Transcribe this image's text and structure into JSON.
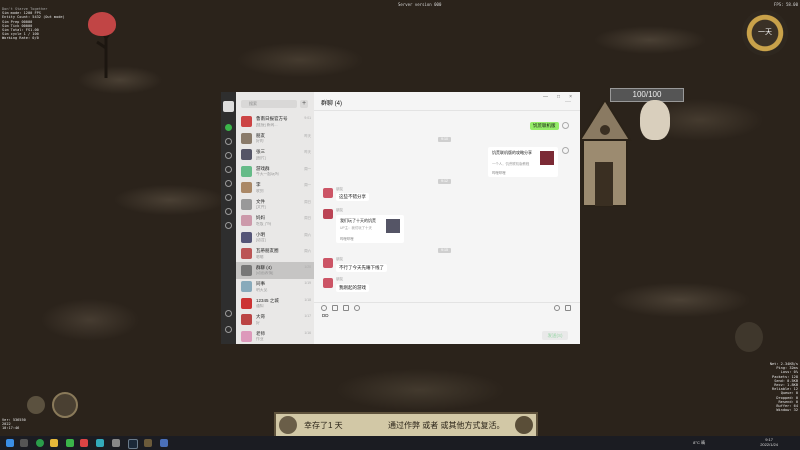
{
  "game": {
    "window_title": "Don't Starve Together",
    "center_title": "Server version 000",
    "fps": "FPS: 58.00",
    "debug_left": [
      "Sim mode: 1200 FPS",
      "Entity Count: 5432 (Out mode)",
      "Sim Prep 00000",
      "Sim Tick 00000",
      "Sim Total: FS1.00",
      "Sim cycle 1 / 100",
      "Working Rate: 0/0"
    ],
    "debug_right": [
      "Net: 2.34KB/s",
      "Ping: 32ms",
      "Loss: 0%",
      "Packets: 128",
      "Send: 0.5KB",
      "Recv: 1.8KB",
      "Reliable: 12",
      "Queue: 0",
      "Dropped: 0",
      "Resend: 0",
      "Buffer: 64",
      "Window: 32"
    ],
    "debug_bottom": [
      "Ver: 536550",
      "2022",
      "10:17:46"
    ],
    "clock_label": "一天",
    "health_label": "100/100",
    "banner_left": "幸存了1 天",
    "banner_right": "通过作弊 或者 或其他方式复活。"
  },
  "taskbar": {
    "weather": "8°C 晴",
    "time": "9:17",
    "date": "2022/1/24"
  },
  "wechat": {
    "search_placeholder": "搜索",
    "plus_label": "+",
    "conversations": [
      {
        "name": "鲁南日报官方号",
        "msg": "[链接] 新闻...",
        "time": "9:01",
        "color": "#c44"
      },
      {
        "name": "朋友",
        "msg": "好的",
        "time": "昨天",
        "color": "#8a7b6a"
      },
      {
        "name": "张三",
        "msg": "[图片]",
        "time": "昨天",
        "color": "#556"
      },
      {
        "name": "游戏群",
        "msg": "今天一起玩吗",
        "time": "周一",
        "color": "#6b8"
      },
      {
        "name": "李",
        "msg": "收到",
        "time": "周一",
        "color": "#a86"
      },
      {
        "name": "文件",
        "msg": "[文件]",
        "time": "周日",
        "color": "#999"
      },
      {
        "name": "妈妈",
        "msg": "吃饭了吗",
        "time": "周日",
        "color": "#c9a"
      },
      {
        "name": "小明",
        "msg": "[语音]",
        "time": "周六",
        "color": "#557"
      },
      {
        "name": "瓦蒂朋友圈",
        "msg": "嗯嗯",
        "time": "周六",
        "color": "#b55"
      },
      {
        "name": "群聊 (4)",
        "msg": "[动画表情]",
        "time": "1/20",
        "color": "#777"
      },
      {
        "name": "同事",
        "msg": "明天见",
        "time": "1/19",
        "color": "#8ab"
      },
      {
        "name": "12345 之城",
        "msg": "通知",
        "time": "1/18",
        "color": "#c33"
      },
      {
        "name": "大哥",
        "msg": "好",
        "time": "1/17",
        "color": "#b44"
      },
      {
        "name": "老师",
        "msg": "作业",
        "time": "1/16",
        "color": "#d9b"
      }
    ],
    "chat_title": "群聊 (4)",
    "win_controls": [
      "—",
      "□",
      "×"
    ],
    "more_label": "···",
    "messages": {
      "me_text": "饥荒联机版",
      "ts1": "9:10",
      "card_me_title": "饥荒联机版的攻略分享",
      "card_me_desc": "一个人，饥荒联机版教程",
      "card_me_src": "哔哩哔哩",
      "ts2": "9:12",
      "sender1": "朋友",
      "them1": "这些不错分享",
      "sender2": "朋友",
      "card_them_title": "我们玩了十天的饥荒",
      "card_them_desc": "UP主：我们玩了十天",
      "card_them_src": "哔哩哔哩",
      "ts3": "9:15",
      "sender3": "朋友",
      "them2": "不行了今天先睡下线了",
      "sender4": "朋友",
      "them3": "我刚起的游戏"
    },
    "input_value": "DD",
    "send_label": "发送(S)"
  }
}
